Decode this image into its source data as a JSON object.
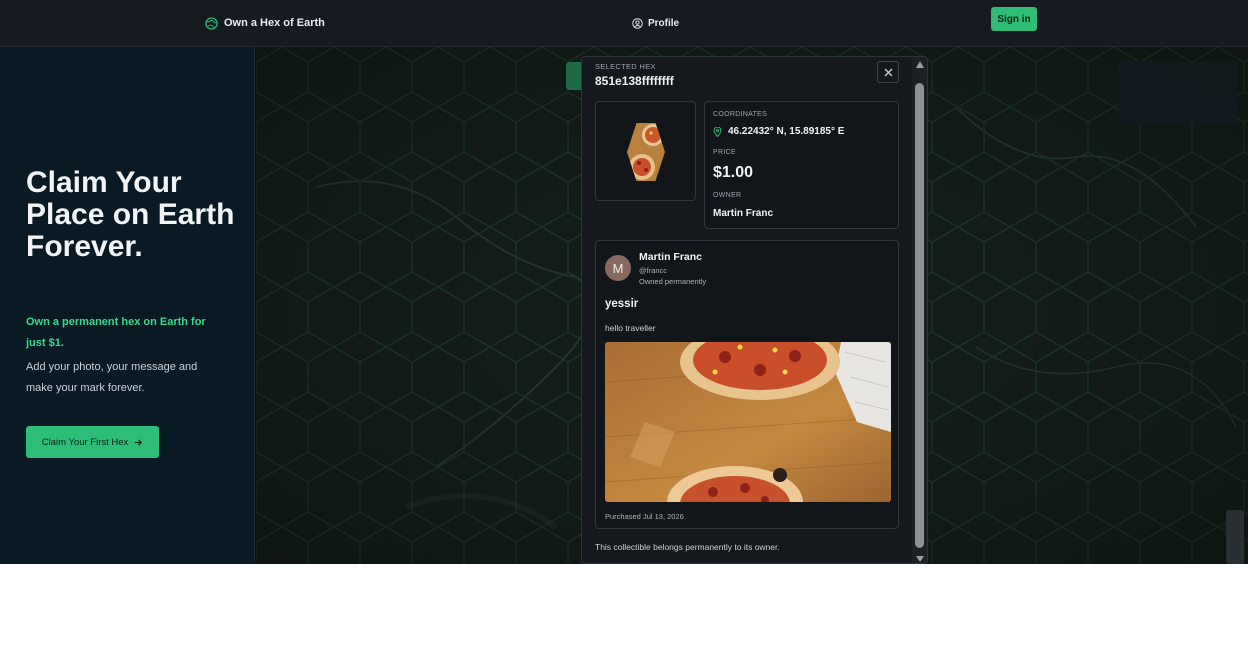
{
  "nav": {
    "brand": "Own a Hex of Earth",
    "profile": "Profile",
    "signin": "Sign in"
  },
  "hero": {
    "title": "Claim Your Place on Earth Forever.",
    "accent": "Own a permanent hex on Earth for just $1.",
    "body": "Add your photo, your message and make your mark forever.",
    "cta": "Claim Your First Hex"
  },
  "modal": {
    "label": "SELECTED HEX",
    "hex_id": "851e138ffffffff",
    "coordinates_label": "COORDINATES",
    "coordinates": "46.22432° N, 15.89185° E",
    "price_label": "PRICE",
    "price": "$1.00",
    "owner_label": "OWNER",
    "owner": "Martin Franc",
    "post": {
      "avatar_letter": "M",
      "name": "Martin Franc",
      "handle": "@francc",
      "owned": "Owned permanently",
      "title": "yessir",
      "message": "hello traveller",
      "purchased": "Purchased Jul 13, 2026"
    },
    "footer": "This collectible belongs permanently to its owner."
  },
  "colors": {
    "accent": "#2ebd76",
    "background": "#0d1117",
    "hero_bg": "#0a1a24",
    "map_hex": "#1f3a2c"
  },
  "icons": [
    "globe-icon",
    "user-circle-icon",
    "arrow-right-icon",
    "close-icon",
    "map-pin-icon"
  ]
}
